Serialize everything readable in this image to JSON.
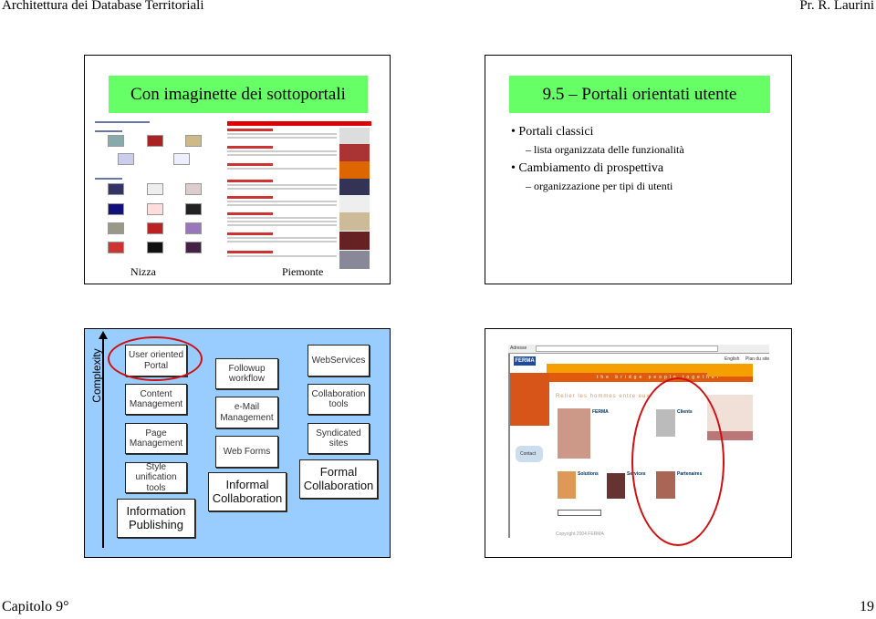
{
  "header": {
    "left": "Architettura dei Database Territoriali",
    "right": "Pr. R. Laurini"
  },
  "footer": {
    "left": "Capitolo 9°",
    "right": "19"
  },
  "slide1": {
    "title": "Con imaginette dei sottoportali",
    "captions": [
      "Nizza",
      "Piemonte"
    ]
  },
  "slide2": {
    "title": "9.5 – Portali orientati utente",
    "bullets": [
      {
        "text": "Portali classici",
        "sub": "lista organizzata delle funzionalità"
      },
      {
        "text": "Cambiamento di prospettiva",
        "sub": "organizzazione per tipi di utenti"
      }
    ]
  },
  "slide3": {
    "axis_label": "Complexity",
    "columns": [
      {
        "items": [
          "User oriented Portal",
          "Content Management",
          "Page Management",
          "Style unification tools"
        ],
        "base": "Information Publishing"
      },
      {
        "items": [
          "Followup workflow",
          "e-Mail Management",
          "Web Forms"
        ],
        "base": "Informal Collaboration"
      },
      {
        "items": [
          "WebServices",
          "Collaboration tools",
          "Syndicated sites"
        ],
        "base": "Formal Collaboration"
      }
    ],
    "highlighted": "User oriented Portal",
    "highlight_color": "#d01010",
    "background": "#99ccff"
  },
  "slide4": {
    "address_label": "Adresse",
    "logo": "FERMA",
    "tagline": "the bridge people together",
    "headline": "Relier les hommes entre eux",
    "top_links": [
      "English",
      "Plan du site"
    ],
    "contact": "Contact",
    "sections": [
      "FERMA",
      "Clients",
      "Solutions",
      "Services",
      "Partenaires"
    ],
    "copyright": "Copyright 2004 FERMA",
    "accent": "#f08a00"
  }
}
